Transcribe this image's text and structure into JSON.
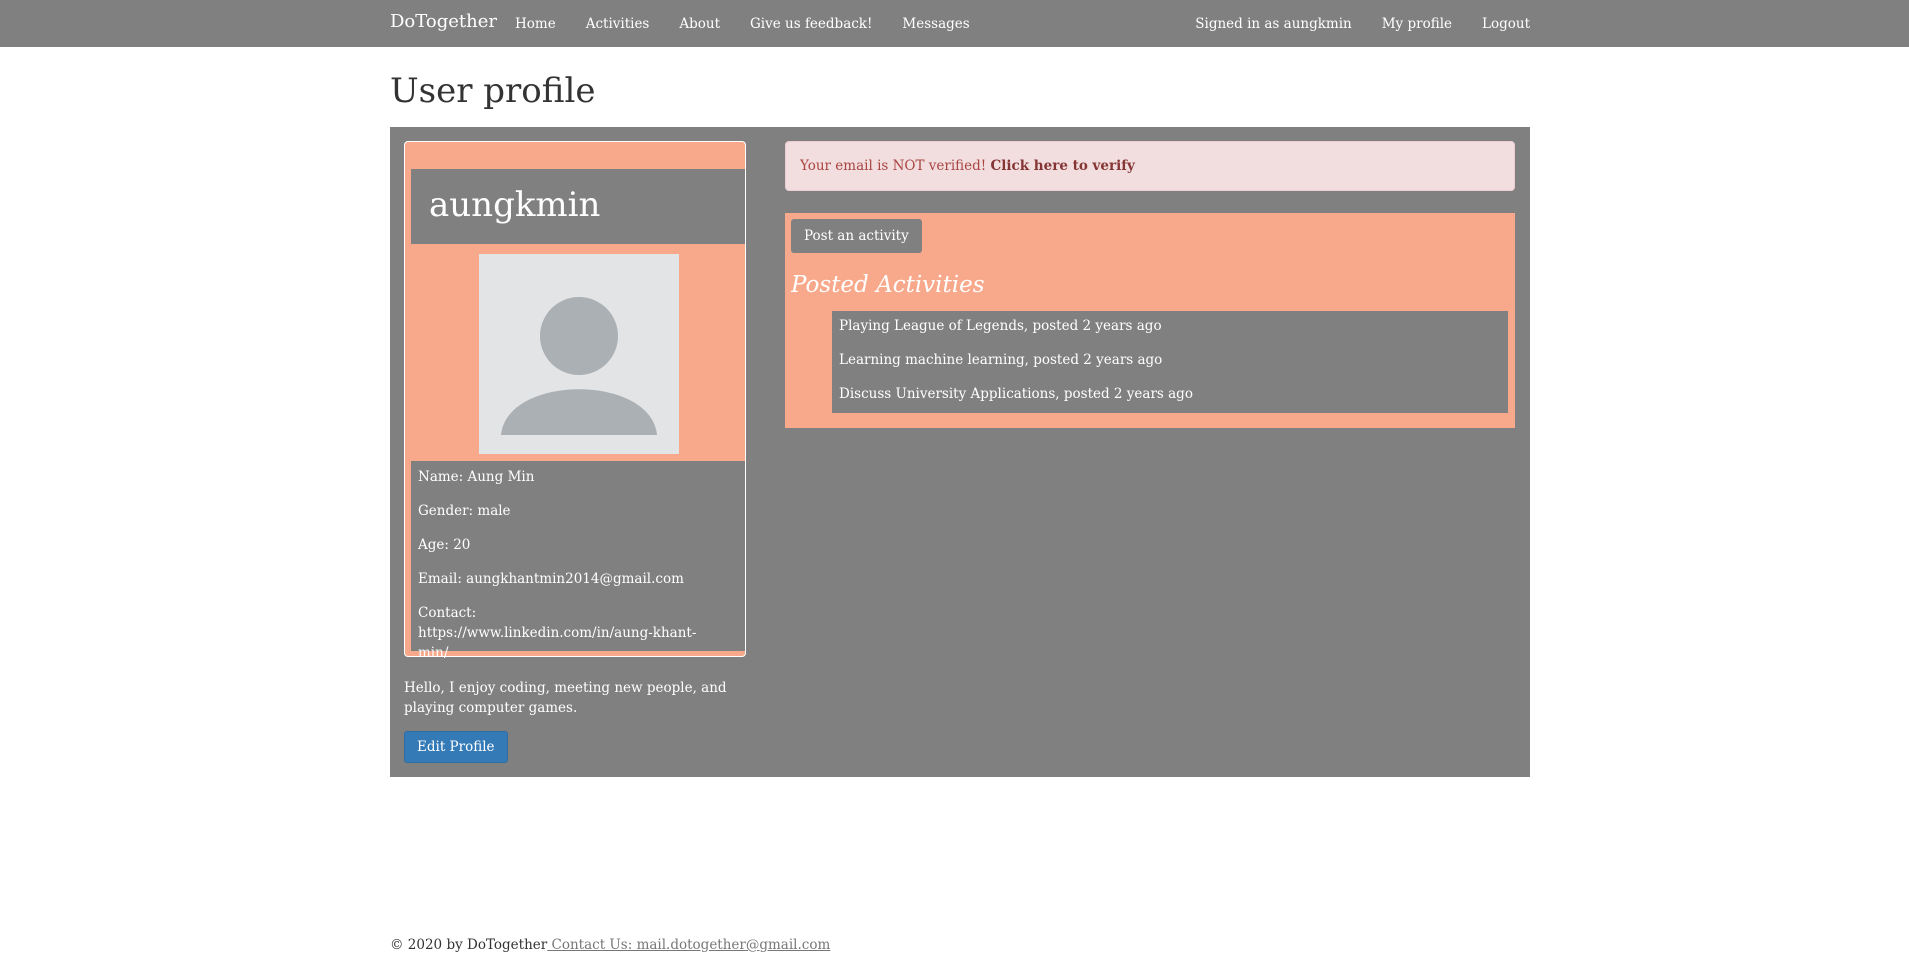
{
  "nav": {
    "brand": "DoTogether",
    "links": [
      "Home",
      "Activities",
      "About",
      "Give us feedback!",
      "Messages"
    ],
    "signed_in": "Signed in as aungkmin",
    "my_profile": "My profile",
    "logout": "Logout"
  },
  "page": {
    "title": "User profile"
  },
  "profile": {
    "username": "aungkmin",
    "name": "Name: Aung Min",
    "gender": "Gender: male",
    "age": "Age: 20",
    "email": "Email: aungkhantmin2014@gmail.com",
    "contact": "Contact: https://www.linkedin.com/in/aung-khant-min/",
    "bio": "Hello, I enjoy coding, meeting new people, and playing computer games.",
    "edit_button": "Edit Profile"
  },
  "alert": {
    "text": "Your email is NOT verified! ",
    "link": "Click here to verify"
  },
  "activities": {
    "post_button": "Post an activity",
    "heading": "Posted Activities",
    "items": [
      "Playing League of Legends, posted 2 years ago",
      "Learning machine learning, posted 2 years ago",
      "Discuss University Applications, posted 2 years ago"
    ]
  },
  "footer": {
    "copyright": "© 2020 by DoTogether",
    "contact": " Contact Us: mail.dotogether@gmail.com"
  },
  "colors": {
    "navbar": "#808080",
    "panel": "#808080",
    "card": "#f8a98b",
    "primary_button": "#337ab7",
    "alert_bg": "#f2dede"
  }
}
